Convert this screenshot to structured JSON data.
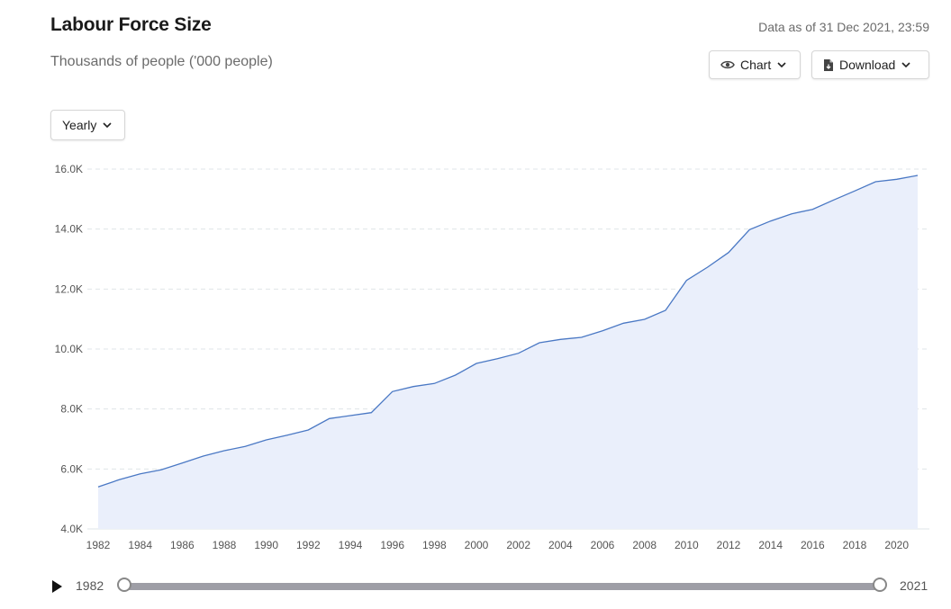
{
  "header": {
    "title": "Labour Force Size",
    "subtitle": "Thousands of people ('000 people)",
    "data_as_of": "Data as of 31 Dec 2021, 23:59"
  },
  "toolbar": {
    "chart_label": "Chart",
    "chart_icon": "eye-icon",
    "download_label": "Download",
    "download_icon": "document-download-icon",
    "frequency_label": "Yearly"
  },
  "slider": {
    "start_label": "1982",
    "end_label": "2021",
    "play_icon": "play-icon"
  },
  "colors": {
    "line": "#4a78c4",
    "area": "#eaeffb",
    "grid": "#dfe5e8"
  },
  "chart_data": {
    "type": "area",
    "title": "Labour Force Size",
    "subtitle": "Thousands of people ('000 people)",
    "xlabel": "",
    "ylabel": "",
    "x": [
      1982,
      1983,
      1984,
      1985,
      1986,
      1987,
      1988,
      1989,
      1990,
      1991,
      1992,
      1993,
      1994,
      1995,
      1996,
      1997,
      1998,
      1999,
      2000,
      2001,
      2002,
      2003,
      2004,
      2005,
      2006,
      2007,
      2008,
      2009,
      2010,
      2011,
      2012,
      2013,
      2014,
      2015,
      2016,
      2017,
      2018,
      2019,
      2020,
      2021
    ],
    "series": [
      {
        "values": [
          5400,
          5640,
          5840,
          5970,
          6200,
          6430,
          6610,
          6750,
          6970,
          7130,
          7300,
          7680,
          7780,
          7880,
          8580,
          8750,
          8850,
          9130,
          9520,
          9680,
          9860,
          10210,
          10320,
          10390,
          10610,
          10860,
          10990,
          11290,
          12290,
          12730,
          13220,
          13980,
          14270,
          14510,
          14660,
          14970,
          15270,
          15580,
          15660,
          15790
        ]
      }
    ],
    "xlim": [
      1982,
      2021
    ],
    "ylim": [
      4000,
      16000
    ],
    "yticks": [
      4000,
      6000,
      8000,
      10000,
      12000,
      14000,
      16000
    ],
    "ytick_labels": [
      "4.0K",
      "6.0K",
      "8.0K",
      "10.0K",
      "12.0K",
      "14.0K",
      "16.0K"
    ],
    "xticks": [
      1982,
      1984,
      1986,
      1988,
      1990,
      1992,
      1994,
      1996,
      1998,
      2000,
      2002,
      2004,
      2006,
      2008,
      2010,
      2012,
      2014,
      2016,
      2018,
      2020
    ],
    "xtick_labels": [
      "1982",
      "1984",
      "1986",
      "1988",
      "1990",
      "1992",
      "1994",
      "1996",
      "1998",
      "2000",
      "2002",
      "2004",
      "2006",
      "2008",
      "2010",
      "2012",
      "2014",
      "2016",
      "2018",
      "2020"
    ],
    "grid": true,
    "legend": "none"
  }
}
